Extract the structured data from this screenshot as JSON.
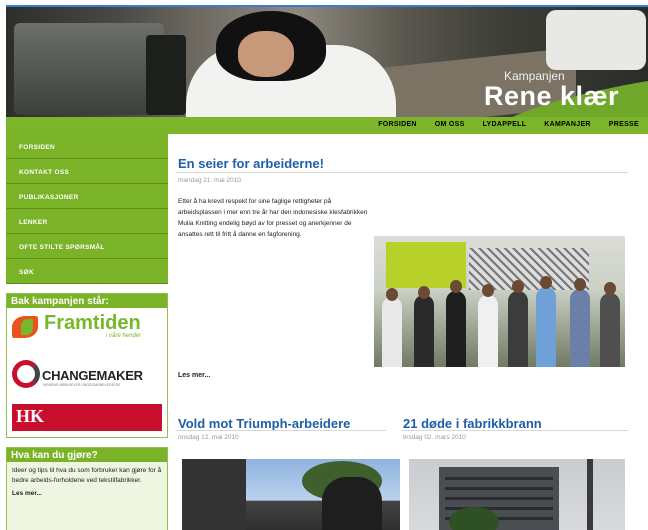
{
  "banner": {
    "subtitle": "Kampanjen",
    "title": "Rene klær"
  },
  "topnav": {
    "items": [
      "FORSIDEN",
      "OM OSS",
      "LYDAPPELL",
      "KAMPANJER",
      "PRESSE"
    ]
  },
  "sidebar": {
    "nav": [
      "FORSIDEN",
      "KONTAKT OSS",
      "PUBLIKASJONER",
      "LENKER",
      "OFTE STILTE SPØRSMÅL",
      "SØK"
    ],
    "support_heading": "Bak kampanjen står:",
    "logos": {
      "framtiden": {
        "word": "Framtiden",
        "tag": "i våre hender"
      },
      "changemaker": {
        "word": "CHANGEMAKER",
        "sub": "KIRKENS NØDHJELPS UNGDOMSBEVEGELSE"
      },
      "hk": {
        "word": "HK"
      }
    },
    "todo_heading": "Hva kan du gjøre?",
    "todo_text": "Ideer og tips til hva du som forbruker kan gjøre  for å bedre arbeids-forholdene ved tekstilfabrikker.",
    "todo_more": "Les mer..."
  },
  "main": {
    "article1": {
      "title": "En seier for arbeiderne!",
      "date": "mandag 21. mai 2010",
      "body": "Etter å ha krevd respekt for sine faglige rettigheter på arbeidsplassen i mer enn tre år har den indonesiske klesfabrikken Mulia Knitting endelig bøyd av for presset og anerkjenner de ansattes rett til fritt å danne en fagforening.",
      "more": "Les mer..."
    },
    "article2": {
      "title": "Vold mot Triumph-arbeidere",
      "date": "onsdag 12. mai 2010"
    },
    "article3": {
      "title": "21 døde i fabrikkbrann",
      "date": "tirsdag 02. mars 2010"
    }
  },
  "colors": {
    "green": "#7ab228",
    "title_blue": "#1f5fa8",
    "hk_red": "#c8102e",
    "framtiden_orange": "#e9531d"
  }
}
